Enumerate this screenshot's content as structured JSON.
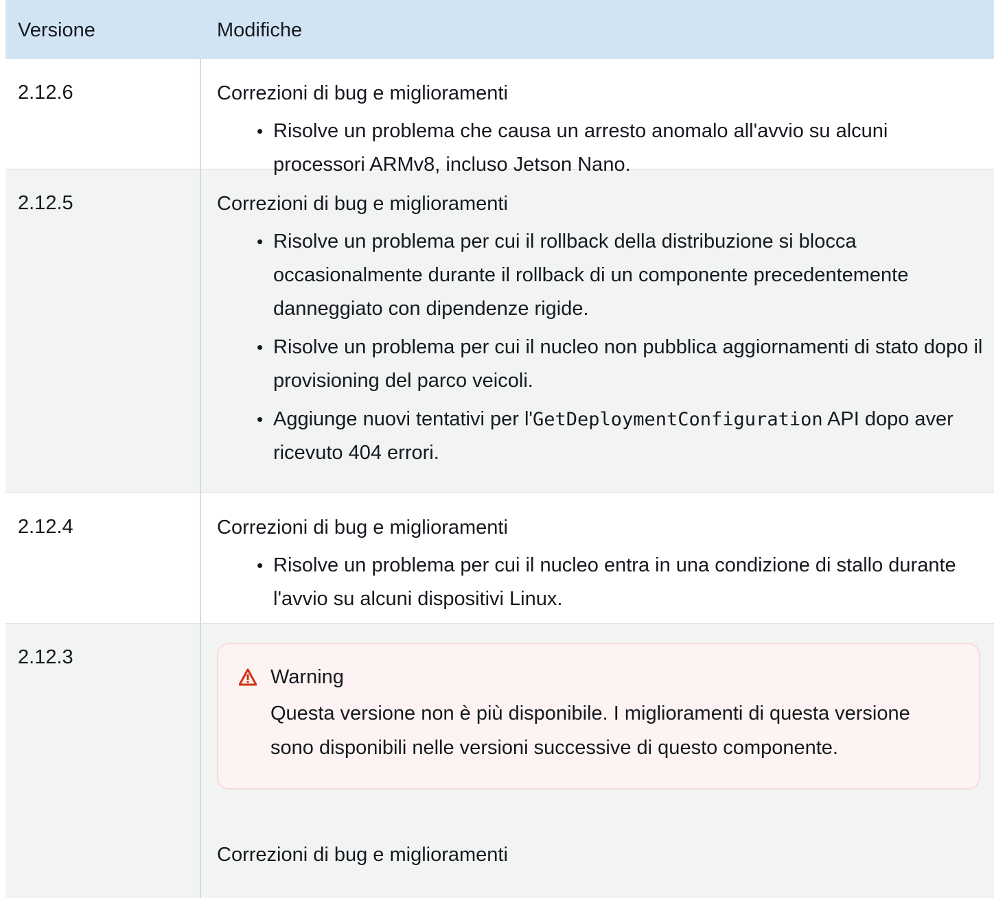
{
  "table": {
    "headers": {
      "version": "Versione",
      "changes": "Modifiche"
    },
    "rows": [
      {
        "version": "2.12.6",
        "intro": "Correzioni di bug e miglioramenti",
        "bullets": [
          "Risolve un problema che causa un arresto anomalo all'avvio su alcuni processori ARMv8, incluso Jetson Nano."
        ]
      },
      {
        "version": "2.12.5",
        "intro": "Correzioni di bug e miglioramenti",
        "bullets": [
          "Risolve un problema per cui il rollback della distribuzione si blocca occasionalmente durante il rollback di un componente precedentemente danneggiato con dipendenze rigide.",
          "Risolve un problema per cui il nucleo non pubblica aggiornamenti di stato dopo il provisioning del parco veicoli."
        ],
        "bullet3": {
          "before": "Aggiunge nuovi tentativi per l'",
          "code": "GetDeploymentConfiguration",
          "after": " API dopo aver ricevuto 404 errori."
        }
      },
      {
        "version": "2.12.4",
        "intro": "Correzioni di bug e miglioramenti",
        "bullets": [
          "Risolve un problema per cui il nucleo entra in una condizione di stallo durante l'avvio su alcuni dispositivi Linux."
        ]
      },
      {
        "version": "2.12.3",
        "warning": {
          "icon": "warning-triangle-icon",
          "title": "Warning",
          "text": "Questa versione non è più disponibile. I miglioramenti di questa versione sono disponibili nelle versioni successive di questo componente."
        },
        "intro": "Correzioni di bug e miglioramenti"
      }
    ]
  },
  "colors": {
    "header_bg": "#d1e4f4",
    "gray_row_bg": "#f2f3f3",
    "warning_bg": "#fcf3f2",
    "warning_icon": "#d13212"
  }
}
